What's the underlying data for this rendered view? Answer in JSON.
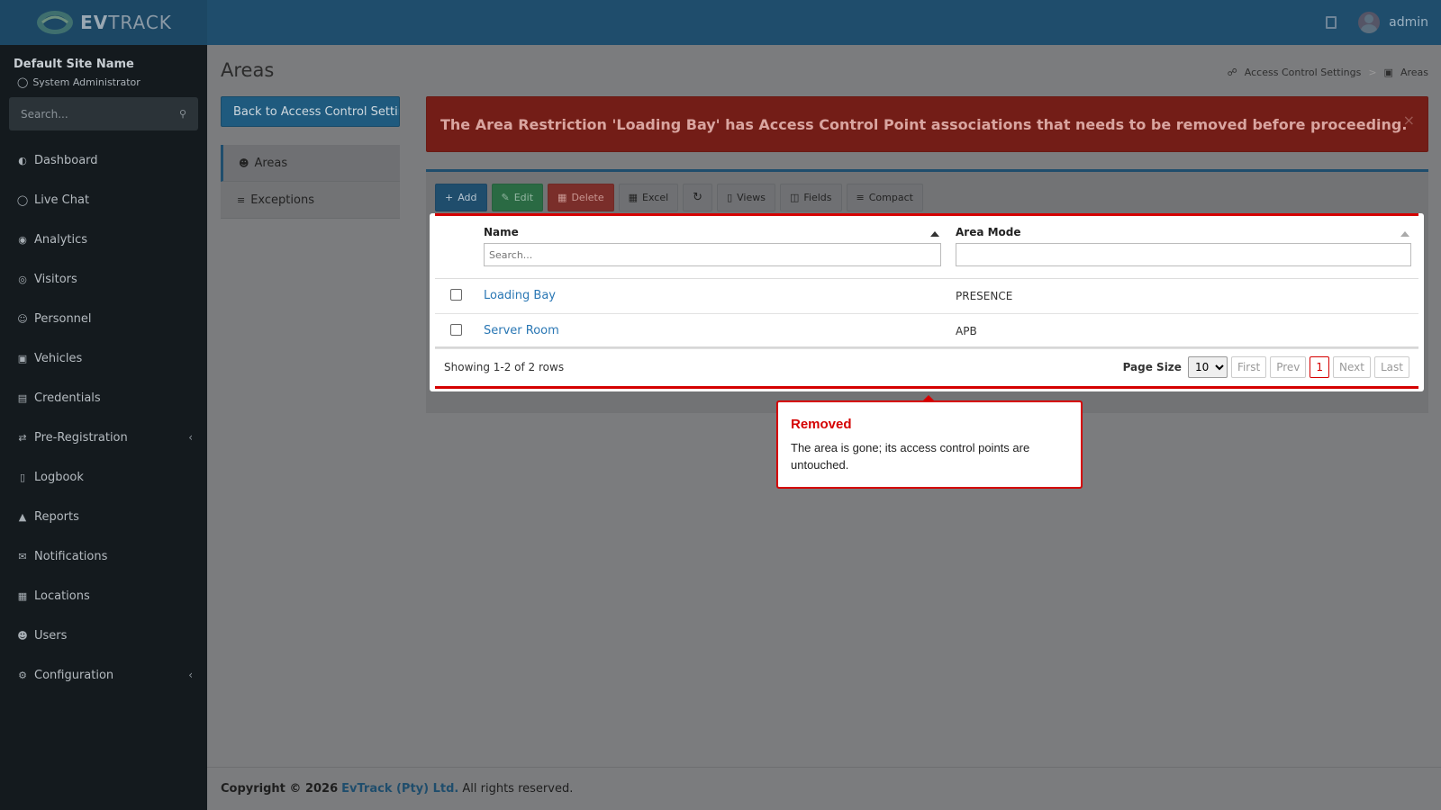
{
  "brand": {
    "logo_prefix": "EV",
    "logo_suffix": "TRACK"
  },
  "header": {
    "username": "admin"
  },
  "sidebar": {
    "site_name": "Default Site Name",
    "role": "System Administrator",
    "search_placeholder": "Search...",
    "items": [
      {
        "label": "Dashboard",
        "icon": "dashboard-icon"
      },
      {
        "label": "Live Chat",
        "icon": "headset-icon"
      },
      {
        "label": "Analytics",
        "icon": "target-icon"
      },
      {
        "label": "Visitors",
        "icon": "eye-icon"
      },
      {
        "label": "Personnel",
        "icon": "personnel-icon"
      },
      {
        "label": "Vehicles",
        "icon": "car-icon"
      },
      {
        "label": "Credentials",
        "icon": "badge-icon"
      },
      {
        "label": "Pre-Registration",
        "icon": "exchange-icon",
        "expandable": true
      },
      {
        "label": "Logbook",
        "icon": "book-icon"
      },
      {
        "label": "Reports",
        "icon": "chart-icon"
      },
      {
        "label": "Notifications",
        "icon": "messages-icon"
      },
      {
        "label": "Locations",
        "icon": "map-icon"
      },
      {
        "label": "Users",
        "icon": "user-key-icon"
      },
      {
        "label": "Configuration",
        "icon": "gear-icon",
        "expandable": true
      }
    ]
  },
  "page": {
    "title": "Areas",
    "breadcrumb": {
      "parent": "Access Control Settings",
      "current": "Areas"
    },
    "back_button": "Back to Access Control Settings",
    "subnav": [
      {
        "label": "Areas",
        "active": true
      },
      {
        "label": "Exceptions",
        "active": false
      }
    ]
  },
  "alert": {
    "message": "The Area Restriction 'Loading Bay' has Access Control Point associations that needs to be removed before proceeding.",
    "close": "×"
  },
  "toolbar": {
    "add": "Add",
    "edit": "Edit",
    "delete": "Delete",
    "excel": "Excel",
    "views": "Views",
    "fields": "Fields",
    "compact": "Compact"
  },
  "grid": {
    "columns": [
      "Name",
      "Area Mode"
    ],
    "name_filter_placeholder": "Search...",
    "rows": [
      {
        "name": "Loading Bay",
        "mode": "PRESENCE"
      },
      {
        "name": "Server Room",
        "mode": "APB"
      }
    ],
    "summary": "Showing 1-2 of 2 rows",
    "page_size_label": "Page Size",
    "page_size": "10",
    "pager": {
      "first": "First",
      "prev": "Prev",
      "current": "1",
      "next": "Next",
      "last": "Last"
    }
  },
  "callout": {
    "title": "Removed",
    "text": "The area is gone; its access control points are untouched."
  },
  "footer": {
    "prefix": "Copyright © 2026",
    "company": "EvTrack (Pty) Ltd.",
    "suffix": "All rights reserved."
  },
  "colors": {
    "header": "#1f4d6c",
    "sidebar": "#141a1e",
    "alert": "#731d17",
    "accent_red": "#d50000",
    "link": "#2a77b4"
  }
}
